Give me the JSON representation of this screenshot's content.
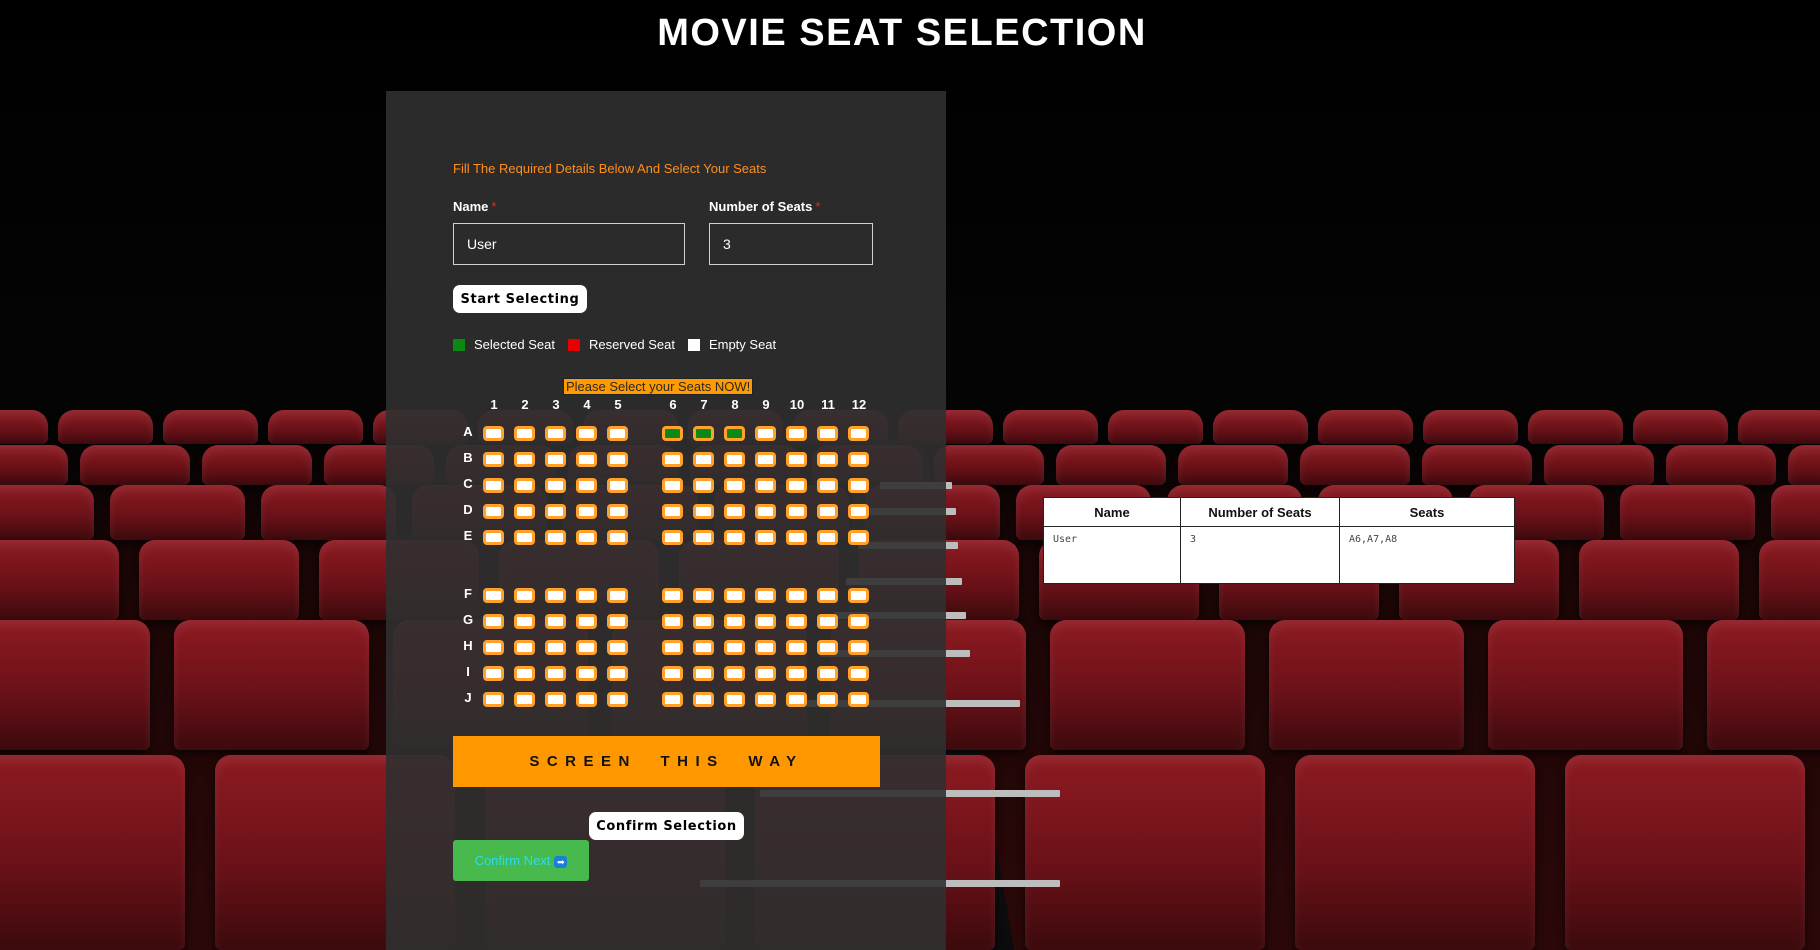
{
  "page": {
    "title": "MOVIE SEAT SELECTION"
  },
  "form": {
    "instruction": "Fill The Required Details Below And Select Your Seats",
    "name_label": "Name",
    "name_value": "User",
    "seats_label": "Number of Seats",
    "seats_value": "3",
    "required_marker": "*",
    "start_button": "Start Selecting"
  },
  "legend": {
    "selected": {
      "label": "Selected Seat",
      "color": "#0a8a12"
    },
    "reserved": {
      "label": "Reserved Seat",
      "color": "#e80000"
    },
    "empty": {
      "label": "Empty Seat",
      "color": "#ffffff"
    }
  },
  "notice": "Please Select your Seats NOW!",
  "seat_map": {
    "columns": [
      "1",
      "2",
      "3",
      "4",
      "5",
      "6",
      "7",
      "8",
      "9",
      "10",
      "11",
      "12"
    ],
    "rows": [
      "A",
      "B",
      "C",
      "D",
      "E",
      "F",
      "G",
      "H",
      "I",
      "J"
    ],
    "selected": [
      "A6",
      "A7",
      "A8"
    ],
    "reserved": []
  },
  "screen_label": "SCREEN THIS WAY",
  "confirm_button": "Confirm Selection",
  "next_button": "Confirm Next",
  "summary_table": {
    "headers": [
      "Name",
      "Number of Seats",
      "Seats"
    ],
    "rows": [
      [
        "User",
        "3",
        "A6,A7,A8"
      ]
    ]
  }
}
